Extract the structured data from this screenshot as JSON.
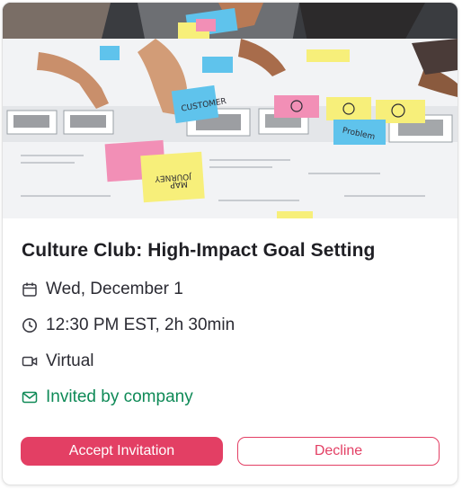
{
  "event": {
    "title": "Culture Club: High-Impact Goal Setting",
    "date": "Wed, December 1",
    "time": "12:30 PM EST, 2h 30min",
    "location": "Virtual",
    "invitation": "Invited by company"
  },
  "icons": {
    "date": "calendar-icon",
    "time": "clock-icon",
    "location": "video-camera-icon",
    "invitation": "mail-icon"
  },
  "image": {
    "sticky_notes": [
      "CUSTOMER",
      "JOURNEY MAP",
      "Problem"
    ]
  },
  "actions": {
    "accept_label": "Accept Invitation",
    "decline_label": "Decline"
  },
  "colors": {
    "accent": "#e33f64",
    "invited": "#0f8a57",
    "text": "#1f1f24"
  }
}
